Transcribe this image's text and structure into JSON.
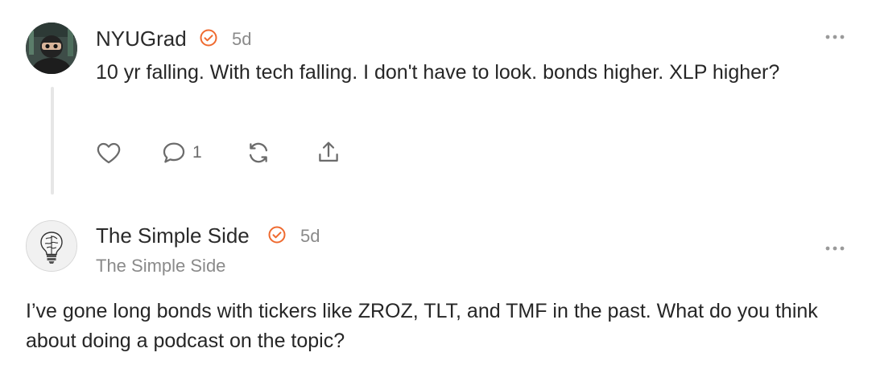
{
  "comments": [
    {
      "author": "NYUGrad",
      "time": "5d",
      "text": "10 yr falling. With tech falling. I don't have to look. bonds higher. XLP higher?",
      "actions": {
        "comment_count": "1"
      }
    },
    {
      "author": "The Simple Side",
      "time": "5d",
      "publication": "The Simple Side",
      "text": "I’ve gone long bonds with tickers like ZROZ, TLT, and TMF in the past. What do you think about doing a podcast on the topic?"
    }
  ],
  "colors": {
    "verified": "#ef6a2f",
    "meta": "#8a8a8a",
    "icon": "#6b6b6b"
  },
  "icons": [
    "heart-icon",
    "comment-icon",
    "restack-icon",
    "share-icon",
    "more-icon",
    "verified-icon"
  ]
}
